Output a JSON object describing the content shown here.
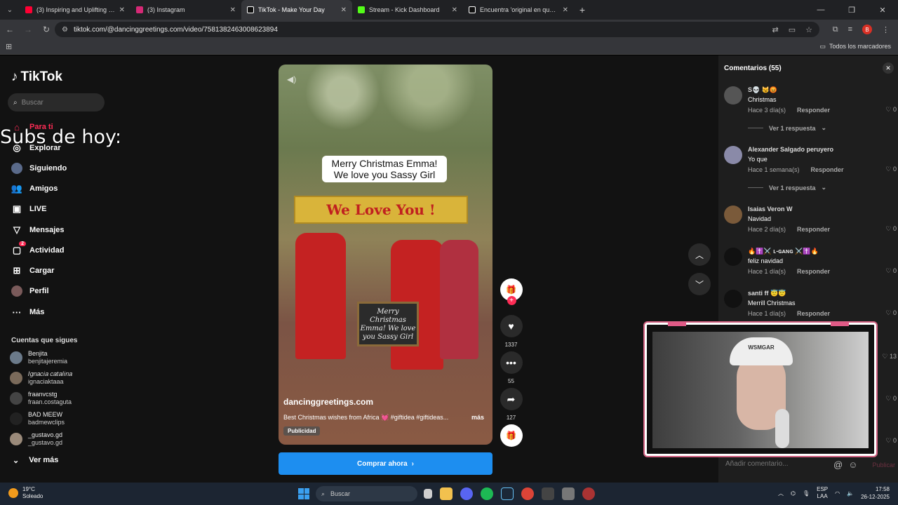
{
  "browser": {
    "tabs": [
      {
        "title": "(3) Inspiring and Uplifting Backg",
        "color": "#ff0033",
        "active": false
      },
      {
        "title": "(3) Instagram",
        "color": "#d62976",
        "active": false
      },
      {
        "title": "TikTok - Make Your Day",
        "color": "#111111",
        "active": true
      },
      {
        "title": "Stream - Kick Dashboard",
        "color": "#53fc18",
        "active": false
      },
      {
        "title": "Encuentra 'original en que aspe",
        "color": "#111111",
        "active": false
      }
    ],
    "url": "tiktok.com/@dancinggreetings.com/video/7581382463008623894",
    "bookmarks_label": "Todos los marcadores",
    "profile_initial": "B"
  },
  "sidebar": {
    "logo": "TikTok",
    "search_placeholder": "Buscar",
    "nav": [
      {
        "label": "Para ti",
        "icon": "home-icon"
      },
      {
        "label": "Explorar",
        "icon": "compass-icon"
      },
      {
        "label": "Siguiendo",
        "icon": "following-icon"
      },
      {
        "label": "Amigos",
        "icon": "friends-icon"
      },
      {
        "label": "LIVE",
        "icon": "live-icon"
      },
      {
        "label": "Mensajes",
        "icon": "messages-icon"
      },
      {
        "label": "Actividad",
        "icon": "activity-icon",
        "badge": "2"
      },
      {
        "label": "Cargar",
        "icon": "upload-icon"
      },
      {
        "label": "Perfil",
        "icon": "profile-icon"
      },
      {
        "label": "Más",
        "icon": "more-icon"
      }
    ],
    "following_header": "Cuentas que sigues",
    "accounts": [
      {
        "name": "Benjita",
        "user": "benjitajeremia"
      },
      {
        "name": "𝐼𝑔𝑛𝑎𝑐𝑖𝑎 𝑐𝑎𝑡𝑎𝑙𝑖𝑛𝑎",
        "user": "ignaciaktaaa"
      },
      {
        "name": "fraanvcstg",
        "user": "fraan.costaguta"
      },
      {
        "name": "BAD MEEW",
        "user": "badmewclips"
      },
      {
        "name": "_gustavo.gd",
        "user": "_gustavo.gd"
      }
    ],
    "see_more": "Ver más"
  },
  "overlay": {
    "subs_text": "Subs de hoy:"
  },
  "video": {
    "bubble_line1": "Merry Christmas  Emma!",
    "bubble_line2": "We love you Sassy Girl",
    "banner": "We Love You !",
    "chalkboard": "Merry Christmas Emma! We love you Sassy Girl",
    "author": "dancinggreetings.com",
    "description": "Best Christmas wishes from Africa 💓 #giftidea #giftideas...",
    "more": "más",
    "ad_label": "Publicidad",
    "cta": "Comprar ahora"
  },
  "actions": {
    "likes": "1337",
    "comments": "55",
    "shares": "127"
  },
  "comments": {
    "title": "Comentarios (55)",
    "input_placeholder": "Añadir comentario...",
    "post_label": "Publicar",
    "items": [
      {
        "name": "S💀 😼😡",
        "text": "Christmas",
        "time": "Hace 3 día(s)",
        "reply": "Responder",
        "likes": "0",
        "replies": "Ver 1 respuesta"
      },
      {
        "name": "Alexander Salgado peruyero",
        "text": "Yo que",
        "time": "Hace 1 semana(s)",
        "reply": "Responder",
        "likes": "0",
        "replies": "Ver 1 respuesta"
      },
      {
        "name": "Isaias Veron W",
        "text": "Navidad",
        "time": "Hace 2 día(s)",
        "reply": "Responder",
        "likes": "0",
        "replies": ""
      },
      {
        "name": "🔥✝️⚔️ ʟ-ɢᴀɴɢ ⚔️✝️🔥",
        "text": "feliz navidad",
        "time": "Hace 1 día(s)",
        "reply": "Responder",
        "likes": "0",
        "replies": ""
      },
      {
        "name": "santi ff 😇😇",
        "text": "Merrill Christmas",
        "time": "Hace 1 día(s)",
        "reply": "Responder",
        "likes": "0",
        "replies": ""
      }
    ],
    "side_likes": [
      "13",
      "0",
      "0"
    ]
  },
  "webcam": {
    "cap_text": "WSMGAR"
  },
  "taskbar": {
    "temp": "19°C",
    "weather": "Soleado",
    "search": "Buscar",
    "lang1": "ESP",
    "lang2": "LAA",
    "time": "17:58",
    "date": "26-12-2025"
  }
}
